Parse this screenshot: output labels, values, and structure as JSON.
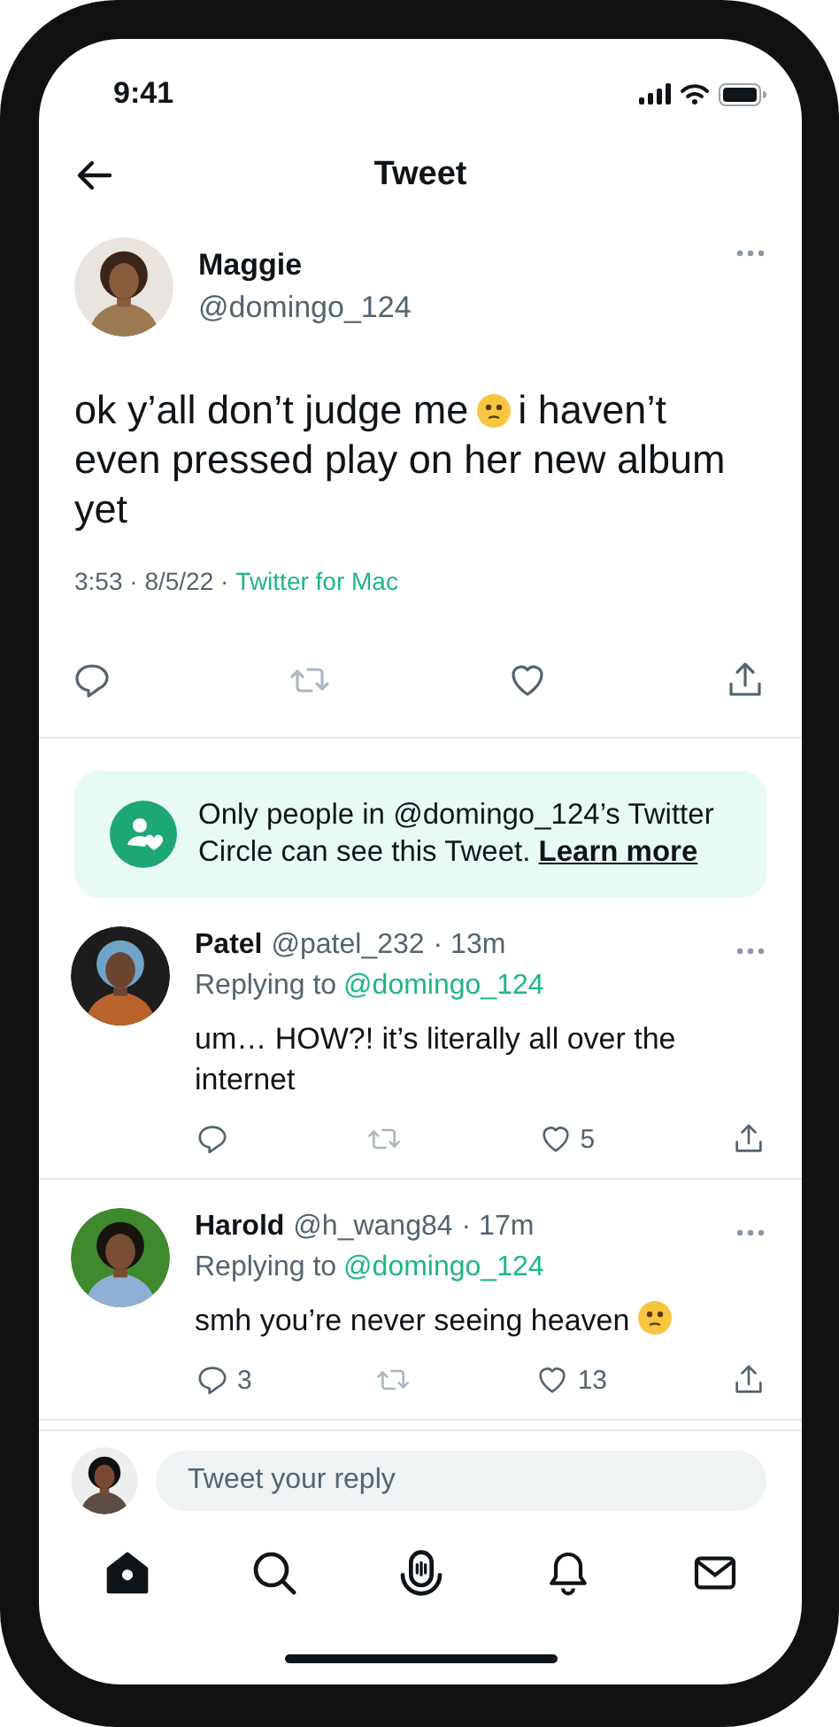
{
  "status_bar": {
    "time": "9:41"
  },
  "header": {
    "title": "Tweet"
  },
  "tweet": {
    "author": {
      "name": "Maggie",
      "handle": "@domingo_124"
    },
    "body": [
      {
        "kind": "text",
        "text": "ok y’all don’t judge me"
      },
      {
        "kind": "emoji"
      },
      {
        "kind": "text",
        "text": "i haven’t even pressed play on her new album yet"
      }
    ],
    "meta": {
      "text": "3:53 · 8/5/22 ·",
      "source": "Twitter for Mac"
    },
    "actions": [
      {
        "kind": "reply"
      },
      {
        "kind": "retweet"
      },
      {
        "kind": "like"
      },
      {
        "kind": "share"
      }
    ]
  },
  "circle_notice": {
    "text": "Only people in @domingo_124’s Twitter Circle can see this Tweet.",
    "link": "Learn more"
  },
  "replies": [
    {
      "name": "Patel",
      "handle": "@patel_232",
      "age": "· 13m",
      "replying_label": "Replying to",
      "replying_to": "@domingo_124",
      "body": [
        {
          "kind": "text",
          "text": "um… HOW?! it’s literally all over the internet"
        }
      ],
      "actions": [
        {
          "kind": "reply"
        },
        {
          "kind": "retweet"
        },
        {
          "kind": "like",
          "count": "5"
        },
        {
          "kind": "share"
        }
      ]
    },
    {
      "name": "Harold",
      "handle": "@h_wang84",
      "age": "· 17m",
      "replying_label": "Replying to",
      "replying_to": "@domingo_124",
      "body": [
        {
          "kind": "text",
          "text": "smh you’re never seeing heaven"
        },
        {
          "kind": "emoji"
        }
      ],
      "actions": [
        {
          "kind": "reply",
          "count": "3"
        },
        {
          "kind": "retweet"
        },
        {
          "kind": "like",
          "count": "13"
        },
        {
          "kind": "share"
        }
      ]
    }
  ],
  "composer": {
    "placeholder": "Tweet your reply"
  },
  "tab_bar": [
    {
      "kind": "home",
      "selected": true
    },
    {
      "kind": "search",
      "selected": false
    },
    {
      "kind": "spaces",
      "selected": false
    },
    {
      "kind": "notifications",
      "selected": false
    },
    {
      "kind": "messages",
      "selected": false
    }
  ]
}
